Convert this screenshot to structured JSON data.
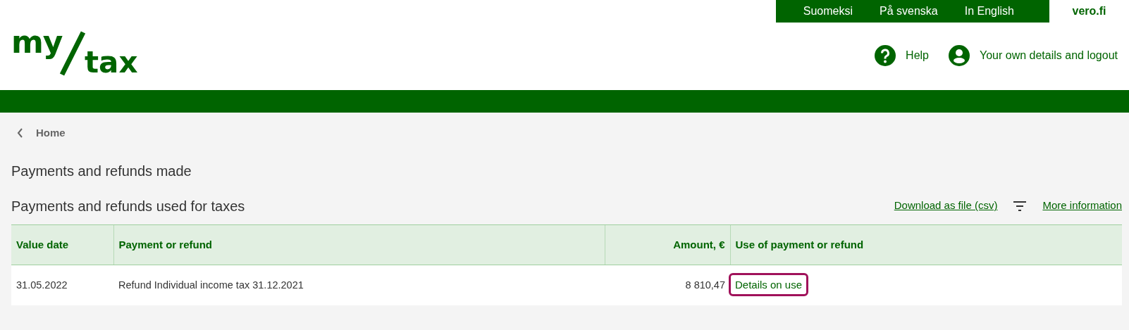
{
  "language_bar": {
    "languages": [
      {
        "label": "Suomeksi"
      },
      {
        "label": "På svenska"
      },
      {
        "label": "In English"
      }
    ],
    "site_link": "vero.fi"
  },
  "logo": {
    "upper": "my",
    "lower": "tax"
  },
  "header_links": [
    {
      "kind": "help",
      "label": "Help"
    },
    {
      "kind": "account",
      "label": "Your own details and logout"
    }
  ],
  "breadcrumb": {
    "label": "Home"
  },
  "page_title": "Payments and refunds made",
  "section": {
    "title": "Payments and refunds used for taxes",
    "download_link": "Download as file (csv)",
    "more_link": "More information"
  },
  "table": {
    "columns": [
      {
        "label": "Value date"
      },
      {
        "label": "Payment or refund"
      },
      {
        "label": "Amount, €"
      },
      {
        "label": "Use of payment or refund"
      }
    ],
    "rows": [
      {
        "value_date": "31.05.2022",
        "payment": "Refund Individual income tax 31.12.2021",
        "amount": "8 810,47",
        "use_link": "Details on use",
        "highlighted": true
      }
    ]
  }
}
